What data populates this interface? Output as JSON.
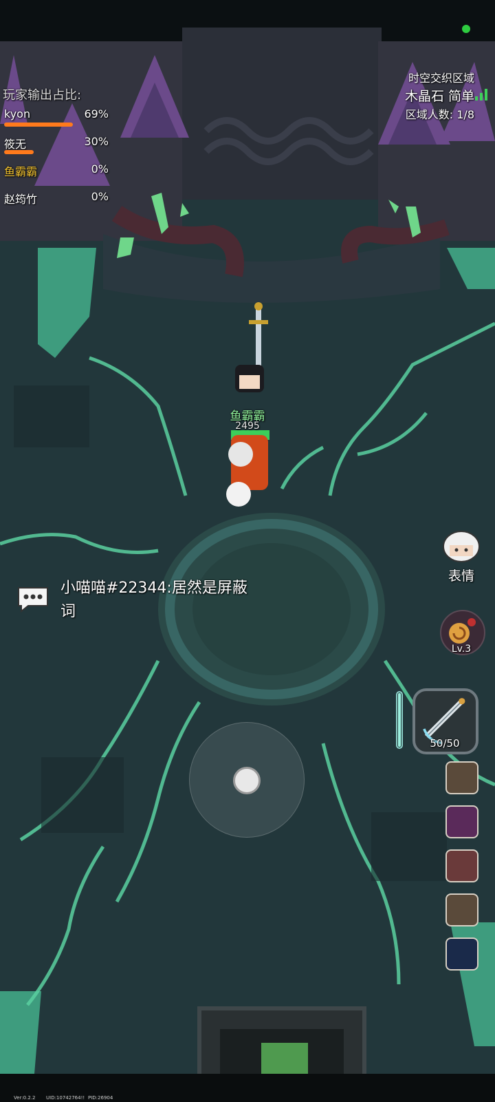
{
  "status": {
    "connection_color": "#2ecc40"
  },
  "damage_panel": {
    "title": "玩家输出占比:",
    "players": [
      {
        "name": "kyon",
        "percent": "69%",
        "share": 0.69,
        "name_color": "#ffffff"
      },
      {
        "name": "筱无",
        "percent": "30%",
        "share": 0.3,
        "name_color": "#ffffff"
      },
      {
        "name": "鱼霸霸",
        "percent": "0%",
        "share": 0,
        "name_color": "#f2c230"
      },
      {
        "name": "赵筠竹",
        "percent": "0%",
        "share": 0,
        "name_color": "#ffffff"
      }
    ]
  },
  "zone": {
    "area": "时空交织区域",
    "name": "木晶石 简单",
    "count": "区域人数: 1/8",
    "signal_color": "#3ecf5a"
  },
  "chat": {
    "icon": "speech-bubble-icon",
    "message": "小喵喵#22344:居然是屏蔽词"
  },
  "player": {
    "name": "鱼霸霸",
    "hp": "2495"
  },
  "hud": {
    "emote_label": "表情",
    "emote_icon": "white-hair-avatar-icon",
    "pet_icon": "snail-shell-icon",
    "pet_level": "Lv.3",
    "weapon_icon": "sword-icon",
    "ammo": "50/50",
    "energy": 1.0,
    "skills": [
      {
        "icon": "claw-slash-icon"
      },
      {
        "icon": "fire-spear-icon"
      },
      {
        "icon": "beast-head-icon"
      },
      {
        "icon": "claw-slash-icon"
      },
      {
        "icon": "blue-portal-icon"
      }
    ]
  },
  "joystick": {
    "icon": "joystick-knob"
  },
  "footer": {
    "version": "Ver:0.2.2",
    "uid": "UID:10742764!!",
    "pid": "PID:26904"
  }
}
